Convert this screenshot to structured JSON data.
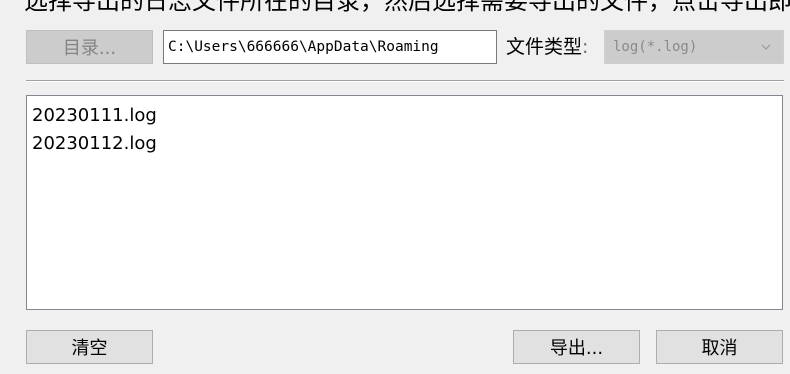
{
  "top_clip": {
    "text": "选择导出的日志文件所在的目录，然后选择需要导出的文件，点击导出即可完成。"
  },
  "dialog": {
    "directory_button": "目录...",
    "path_value": "C:\\Users\\666666\\AppData\\Roaming",
    "file_type_label": "文件类型",
    "file_type_colon": ":",
    "file_type_value": "log(*.log)",
    "files": [
      "20230111.log",
      "20230112.log"
    ],
    "clear_button": "清空",
    "export_button": "导出...",
    "cancel_button": "取消"
  },
  "icons": {
    "dropdown": "chevron-down-icon"
  },
  "colors": {
    "background": "#f0f0f0",
    "disabled": "#cccccc",
    "button": "#e1e1e1"
  }
}
